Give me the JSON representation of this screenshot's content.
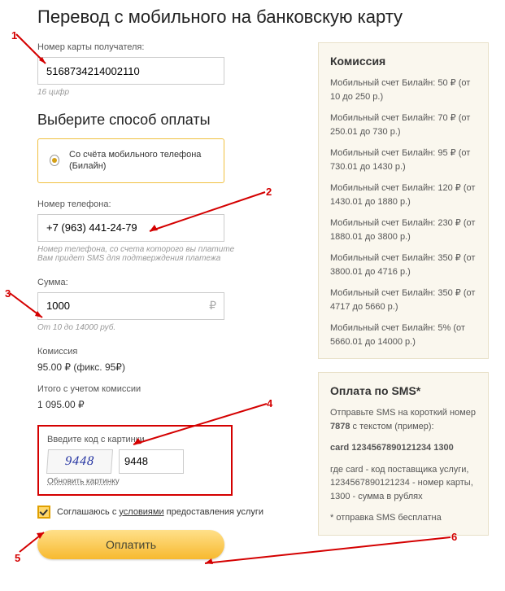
{
  "title": "Перевод с мобильного на банковскую карту",
  "card": {
    "label": "Номер карты получателя:",
    "value": "5168734214002110",
    "hint": "16 цифр"
  },
  "payment_method": {
    "heading": "Выберите способ оплаты",
    "option": "Со счёта мобильного телефона (Билайн)"
  },
  "phone": {
    "label": "Номер телефона:",
    "value": "+7 (963) 441-24-79",
    "hint1": "Номер телефона, со счета которого вы платите",
    "hint2": "Вам придет SMS для подтверждения платежа"
  },
  "amount": {
    "label": "Сумма:",
    "value": "1000",
    "currency": "₽",
    "hint": "От 10 до 14000 руб."
  },
  "fee": {
    "label": "Комиссия",
    "value": "95.00 ₽ (фикс. 95₽)"
  },
  "total": {
    "label": "Итого с учетом комиссии",
    "value": "1 095.00 ₽"
  },
  "captcha": {
    "label": "Введите код с картинки",
    "image_text": "9448",
    "input_value": "9448",
    "refresh": "Обновить картинку"
  },
  "agree": {
    "pre": "Соглашаюсь с ",
    "link": "условиями",
    "post": " предоставления услуги"
  },
  "pay_button": "Оплатить",
  "commission_panel": {
    "heading": "Комиссия",
    "tiers": [
      "Мобильный счет Билайн: 50 ₽ (от 10 до 250 р.)",
      "Мобильный счет Билайн: 70 ₽ (от 250.01 до 730 р.)",
      "Мобильный счет Билайн: 95 ₽ (от 730.01 до 1430 р.)",
      "Мобильный счет Билайн: 120 ₽ (от 1430.01 до 1880 р.)",
      "Мобильный счет Билайн: 230 ₽ (от 1880.01 до 3800 р.)",
      "Мобильный счет Билайн: 350 ₽ (от 3800.01 до 4716 р.)",
      "Мобильный счет Билайн: 350 ₽ (от 4717 до 5660 р.)",
      "Мобильный счет Билайн: 5% (от 5660.01 до 14000 р.)"
    ]
  },
  "sms_panel": {
    "heading": "Оплата по SMS*",
    "line1a": "Отправьте SMS на короткий номер ",
    "line1b": "7878",
    "line1c": " с текстом (пример):",
    "example": "card 1234567890121234 1300",
    "line2": "где card - код поставщика услуги, 1234567890121234 - номер карты, 1300 - сумма в рублях",
    "note": "* отправка SMS бесплатна"
  },
  "annotations": {
    "n1": "1",
    "n2": "2",
    "n3": "3",
    "n4": "4",
    "n5": "5",
    "n6": "6"
  }
}
